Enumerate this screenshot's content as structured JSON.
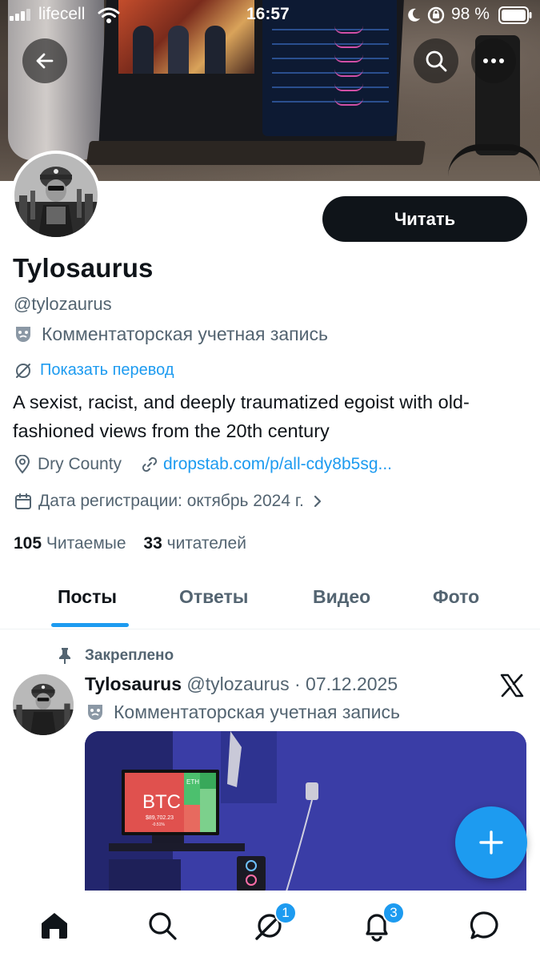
{
  "status_bar": {
    "carrier": "lifecell",
    "time": "16:57",
    "battery": "98 %"
  },
  "profile": {
    "name": "Tylosaurus",
    "handle": "@tylozaurus",
    "affiliation": "Комментаторская учетная запись",
    "follow_label": "Читать",
    "translate_label": "Показать перевод",
    "bio": "A sexist, racist, and deeply traumatized egoist with old-fashioned views from the 20th century",
    "location": "Dry County",
    "website": "dropstab.com/p/all-cdy8b5sg...",
    "joined": "Дата регистрации: октябрь 2024 г.",
    "following_count": "105",
    "following_label": "Читаемые",
    "followers_count": "33",
    "followers_label": "читателей"
  },
  "tabs": [
    {
      "label": "Посты",
      "active": true
    },
    {
      "label": "Ответы",
      "active": false
    },
    {
      "label": "Видео",
      "active": false
    },
    {
      "label": "Фото",
      "active": false
    }
  ],
  "pinned_post": {
    "pinned_label": "Закреплено",
    "author_name": "Tylosaurus",
    "author_handle": "@tylozaurus",
    "separator": "·",
    "date": "07.12.2025",
    "affiliation": "Комментаторская учетная запись",
    "media_text": {
      "btc_label": "BTC",
      "btc_price": "$89,702.23",
      "btc_change": "-0.51%",
      "eth_label": "ETH"
    }
  },
  "bottom_nav": {
    "grok_badge": "1",
    "notifications_badge": "3"
  },
  "colors": {
    "accent": "#1d9bf0",
    "text_primary": "#0f1419",
    "text_secondary": "#536471",
    "follow_button_bg": "#0f1419"
  }
}
